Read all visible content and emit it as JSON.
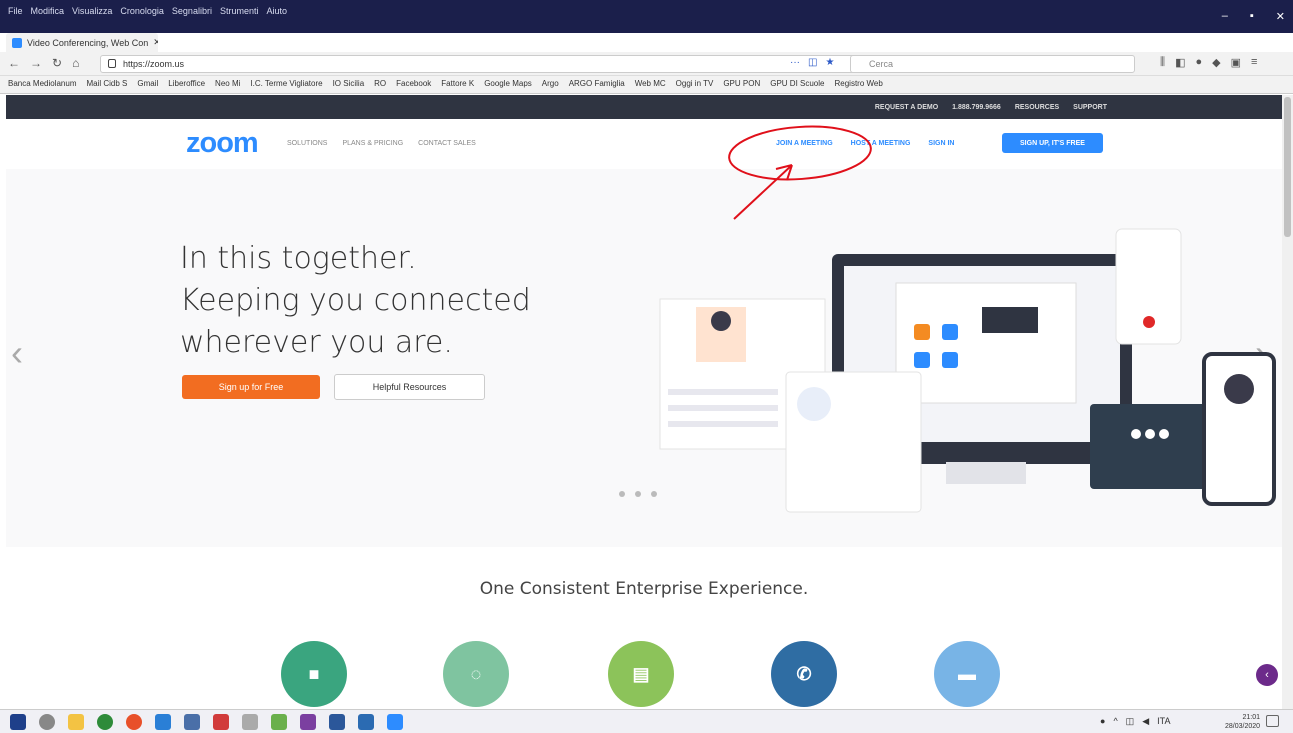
{
  "browser": {
    "menus": [
      "File",
      "Modifica",
      "Visualizza",
      "Cronologia",
      "Segnalibri",
      "Strumenti",
      "Aiuto"
    ],
    "tab_title": "Video Conferencing, Web Con",
    "url": "https://zoom.us",
    "search_placeholder": "Cerca",
    "bookmarks": [
      "Banca Mediolanum",
      "Mail Cidb S",
      "Gmail",
      "Liberoffice",
      "Neo Mi",
      "I.C. Terme Vigliatore",
      "IO Sicilia",
      "RO",
      "Facebook",
      "Fattore K",
      "Google Maps",
      "Argo",
      "ARGO Famiglia",
      "Web MC",
      "Oggi in TV",
      "GPU PON",
      "GPU DI Scuole",
      "Registro Web"
    ]
  },
  "zoom_topbar": [
    "REQUEST A DEMO",
    "1.888.799.9666",
    "RESOURCES",
    "SUPPORT"
  ],
  "nav": {
    "logo": "zoom",
    "left": [
      "SOLUTIONS",
      "PLANS & PRICING",
      "CONTACT SALES"
    ],
    "join": "JOIN A MEETING",
    "host": "HOST A MEETING",
    "signin": "SIGN IN",
    "signup": "SIGN UP, IT'S FREE"
  },
  "hero": {
    "line1": "In this together.",
    "line2": "Keeping you connected",
    "line3": "wherever you are.",
    "btn_primary": "Sign up for Free",
    "btn_secondary": "Helpful Resources"
  },
  "tagline": "One Consistent Enterprise Experience.",
  "features": [
    {
      "icon": "video-camera-icon",
      "color": "#3aa57f"
    },
    {
      "icon": "webinar-icon",
      "color": "#7fc4a0"
    },
    {
      "icon": "rooms-icon",
      "color": "#8cc35a"
    },
    {
      "icon": "phone-icon",
      "color": "#2f6da3"
    },
    {
      "icon": "chat-icon",
      "color": "#78b4e6"
    }
  ],
  "taskbar": {
    "time": "21:01",
    "date": "28/03/2020",
    "lang": "ITA"
  }
}
